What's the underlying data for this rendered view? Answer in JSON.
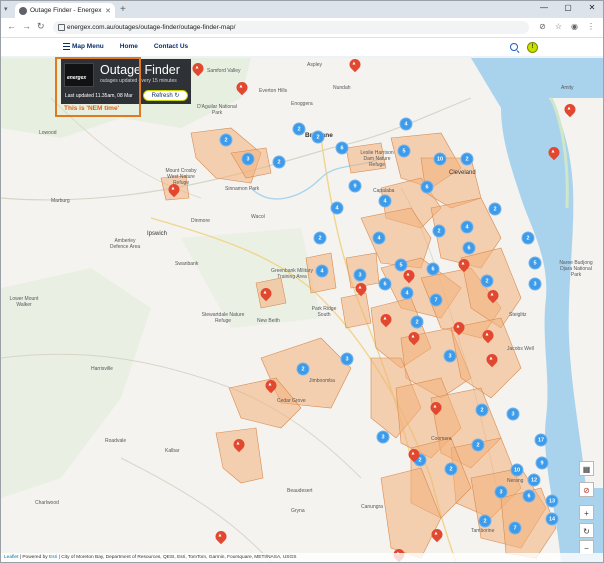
{
  "browser": {
    "tab_title": "Outage Finder - Energex",
    "url": "energex.com.au/outages/outage-finder/outage-finder-map/"
  },
  "site_nav": {
    "menu_label": "Map Menu",
    "home_label": "Home",
    "contact_label": "Contact Us"
  },
  "panel": {
    "logo_text": "energex",
    "title": "Outage Finder",
    "subtitle": "outages updated every 15 minutes",
    "last_updated": "Last updated 11.35am, 08 Mar",
    "refresh_label": "Refresh ↻",
    "annotation": "This is 'NEM time'"
  },
  "places": [
    {
      "name": "Samford Valley"
    },
    {
      "name": "Aspley"
    },
    {
      "name": "Nundah"
    },
    {
      "name": "Everton Hills"
    },
    {
      "name": "Enoggera"
    },
    {
      "name": "D'Aguilar National Park"
    },
    {
      "name": "Brisbane"
    },
    {
      "name": "Lowood"
    },
    {
      "name": "Mount Crosby West Nature Refuge"
    },
    {
      "name": "Sinnamon Park"
    },
    {
      "name": "Marburg"
    },
    {
      "name": "Ipswich"
    },
    {
      "name": "Wacol"
    },
    {
      "name": "Dinmore"
    },
    {
      "name": "Amberley Defence Area"
    },
    {
      "name": "Swanbank"
    },
    {
      "name": "Leslie Harrison Dam Nature Refuge"
    },
    {
      "name": "Cleveland"
    },
    {
      "name": "Capalaba"
    },
    {
      "name": "Greenbank Military Training Area"
    },
    {
      "name": "Park Ridge South"
    },
    {
      "name": "New Beith"
    },
    {
      "name": "Stewartdale Nature Refuge"
    },
    {
      "name": "Lower Mount Walker"
    },
    {
      "name": "Harrisville"
    },
    {
      "name": "Cedar Grove"
    },
    {
      "name": "Jimboomba"
    },
    {
      "name": "Coomera"
    },
    {
      "name": "Roadvale"
    },
    {
      "name": "Kalbar"
    },
    {
      "name": "Beaudesert"
    },
    {
      "name": "Canungra"
    },
    {
      "name": "Charlwood"
    },
    {
      "name": "Nerang"
    },
    {
      "name": "Tamborine"
    },
    {
      "name": "Gryna"
    },
    {
      "name": "Jacobs Well"
    },
    {
      "name": "Steiglitz"
    },
    {
      "name": "Naree Budjong Djara National Park"
    },
    {
      "name": "Amity"
    }
  ],
  "clusters": [
    "2",
    "3",
    "2",
    "2",
    "4",
    "6",
    "2",
    "5",
    "10",
    "2",
    "9",
    "6",
    "4",
    "2",
    "4",
    "4",
    "4",
    "2",
    "2",
    "4",
    "3",
    "6",
    "5",
    "6",
    "6",
    "4",
    "7",
    "2",
    "2",
    "5",
    "3",
    "2",
    "3",
    "2",
    "3",
    "3",
    "2",
    "3",
    "17",
    "9",
    "10",
    "12",
    "6",
    "13",
    "14",
    "2",
    "7",
    "2",
    "2",
    "2",
    "3"
  ],
  "attribution": {
    "leaflet": "Leaflet",
    "powered": "| Powered by",
    "esri": "Esri",
    "rest": "| City of Moreton Bay, Department of Resources, QESI, Esri, TomTom, Garmin, Foursquare, METI/NASA, USGS"
  },
  "controls": {
    "calendar_icon": "calendar-icon",
    "no_power_icon": "no-power-icon",
    "zoom_in": "+",
    "rotate": "↻",
    "zoom_out": "−"
  },
  "colors": {
    "cluster": "#3d9be9",
    "outage_pin": "#e2472f",
    "outage_area": "#f3b07a",
    "water": "#a9d3ec",
    "panel_bg": "#2e3136",
    "annotation": "#e07a20"
  }
}
